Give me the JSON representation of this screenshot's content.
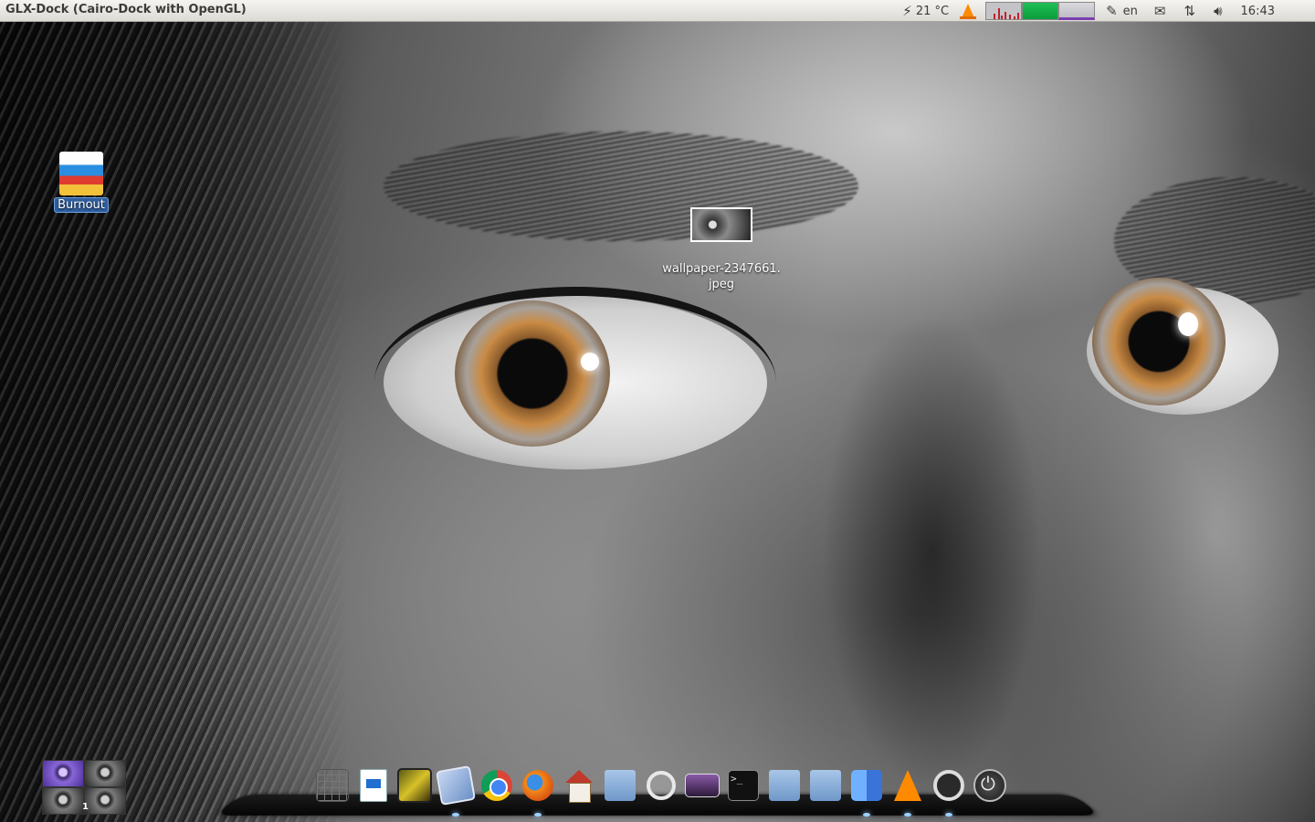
{
  "panel": {
    "title": "GLX-Dock (Cairo-Dock with OpenGL)",
    "weather": "21 °C",
    "keyboard_layout": "en",
    "clock": "16:43"
  },
  "desktop": {
    "icons": [
      {
        "label": "Burnout",
        "icon": "game-icon"
      },
      {
        "label": "wallpaper-2347661.\njpeg",
        "icon": "image-file-icon"
      }
    ]
  },
  "workspace_switcher": {
    "current_workspace": "1"
  },
  "dock": {
    "launchers": [
      {
        "icon": "calculator-icon"
      },
      {
        "icon": "document-icon"
      },
      {
        "icon": "image-viewer-icon"
      },
      {
        "icon": "mail-icon"
      },
      {
        "icon": "chrome-icon"
      },
      {
        "icon": "firefox-icon"
      },
      {
        "icon": "home-icon"
      },
      {
        "icon": "folder-icon"
      },
      {
        "icon": "search-icon"
      },
      {
        "icon": "display-icon"
      },
      {
        "icon": "terminal-icon"
      },
      {
        "icon": "folder-pictures-icon"
      },
      {
        "icon": "folder-tools-icon"
      },
      {
        "icon": "finder-icon"
      },
      {
        "icon": "vlc-icon"
      },
      {
        "icon": "refresh-icon"
      },
      {
        "icon": "power-icon"
      }
    ]
  },
  "colors": {
    "panel_bg": "#dcdad5",
    "accent_vlc": "#ff8a00",
    "memory_meter": "#1fbf55",
    "net_meter": "#7b3fb0"
  }
}
